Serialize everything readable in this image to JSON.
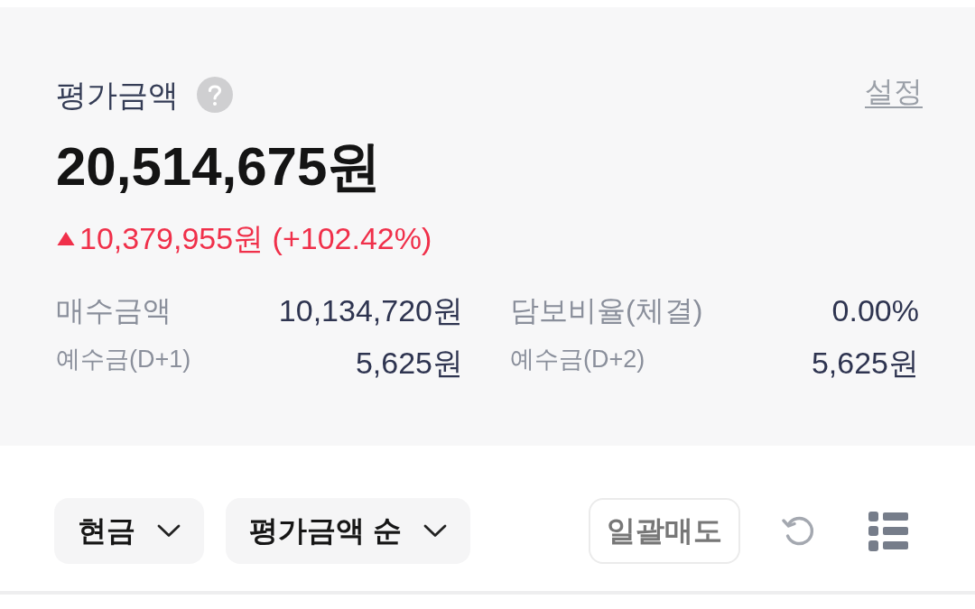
{
  "summary": {
    "title": "평가금액",
    "settings_link": "설정",
    "total": "20,514,675원",
    "change": {
      "rising": true,
      "text": "10,379,955원 (+102.42%)"
    },
    "details": [
      {
        "label": "매수금액",
        "value": "10,134,720원",
        "kind": "primary"
      },
      {
        "label": "담보비율(체결)",
        "value": "0.00%",
        "kind": "primary"
      },
      {
        "label": "예수금(D+1)",
        "value": "5,625원",
        "kind": "secondary"
      },
      {
        "label": "예수금(D+2)",
        "value": "5,625원",
        "kind": "secondary"
      }
    ]
  },
  "toolbar": {
    "filters": [
      {
        "label": "현금"
      },
      {
        "label": "평가금액 순"
      }
    ],
    "sell_all_button": "일괄매도"
  }
}
